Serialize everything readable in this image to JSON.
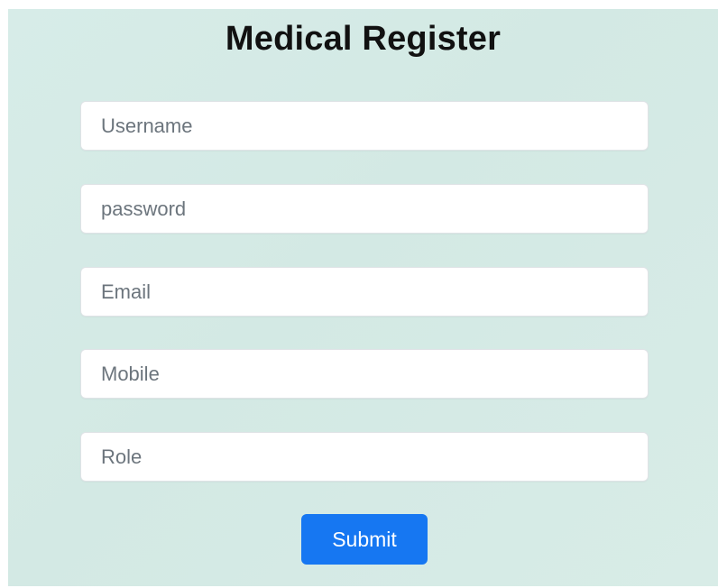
{
  "form": {
    "title": "Medical Register",
    "fields": [
      {
        "placeholder": "Username",
        "value": ""
      },
      {
        "placeholder": "password",
        "value": ""
      },
      {
        "placeholder": "Email",
        "value": ""
      },
      {
        "placeholder": "Mobile",
        "value": ""
      },
      {
        "placeholder": "Role",
        "value": ""
      }
    ],
    "submit_label": "Submit"
  },
  "colors": {
    "background": "#d5eae6",
    "button": "#1677f2",
    "title": "#111111",
    "placeholder": "#6c757d"
  }
}
